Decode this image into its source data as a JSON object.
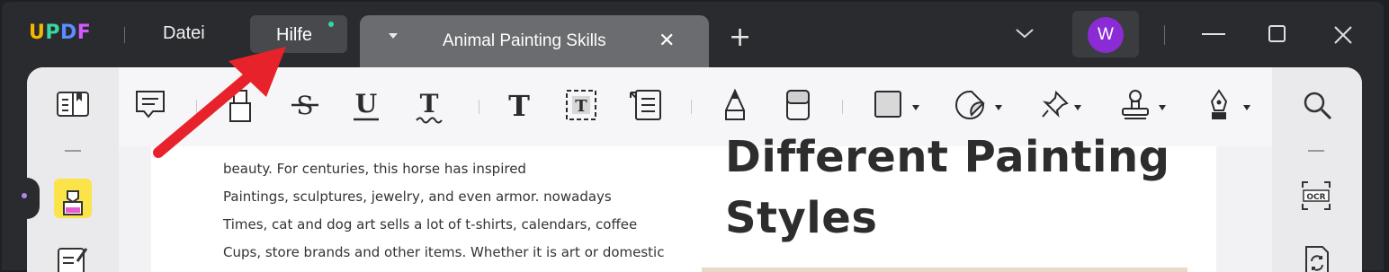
{
  "app": {
    "logo": [
      "U",
      "P",
      "D",
      "F"
    ],
    "logo_colors": [
      "#f5b800",
      "#3bd6a3",
      "#5a8dff",
      "#d05bff"
    ]
  },
  "menu": {
    "file_label": "Datei",
    "help_label": "Hilfe"
  },
  "tab": {
    "title": "Animal Painting Skills",
    "close_glyph": "✕",
    "new_tab_glyph": "+"
  },
  "account": {
    "avatar_letter": "W",
    "avatar_color": "#8b2bd6"
  },
  "toolbar": {
    "tools": [
      "comment-icon",
      "highlighter-icon",
      "strikethrough-icon",
      "underline-icon",
      "squiggly-icon",
      "text-icon",
      "text-box-icon",
      "text-callout-icon",
      "pencil-icon",
      "eraser-icon",
      "shape-icon",
      "sticker-icon",
      "pin-icon",
      "stamp-icon",
      "signature-icon"
    ]
  },
  "left_sidebar": [
    "reader-icon",
    "annotate-icon",
    "edit-icon"
  ],
  "right_sidebar": [
    "search-icon",
    "ocr-icon",
    "convert-icon"
  ],
  "document": {
    "paragraph_lines": [
      "beauty. For centuries, this horse has inspired",
      "Paintings, sculptures, jewelry, and even armor. nowadays",
      "Times, cat and dog art sells a lot of t-shirts, calendars, coffee",
      "Cups, store brands and other items. Whether it is art or domestic"
    ],
    "heading_line1": "Different Painting",
    "heading_line2": "Styles"
  },
  "ocr_label": "OCR",
  "accent_color": "#e8222b"
}
